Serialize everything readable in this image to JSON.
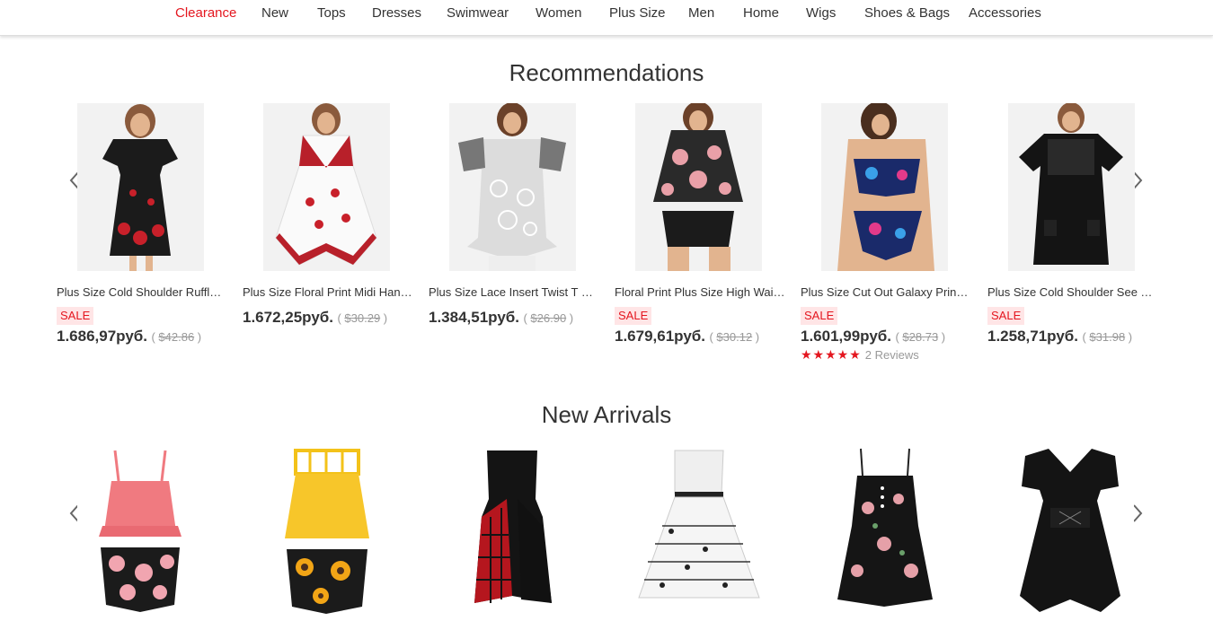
{
  "nav": {
    "items": [
      {
        "label": "Clearance",
        "highlight": true
      },
      {
        "label": "New"
      },
      {
        "label": "Tops"
      },
      {
        "label": "Dresses"
      },
      {
        "label": "Swimwear"
      },
      {
        "label": "Women"
      },
      {
        "label": "Plus Size"
      },
      {
        "label": "Men"
      },
      {
        "label": "Home"
      },
      {
        "label": "Wigs"
      },
      {
        "label": "Shoes & Bags"
      },
      {
        "label": "Accessories"
      }
    ]
  },
  "recommendations": {
    "title": "Recommendations",
    "products": [
      {
        "title": "Plus Size Cold Shoulder Ruffle Floral Print Dress",
        "sale": "SALE",
        "price": "1.686,97руб.",
        "old_price": "$42.86"
      },
      {
        "title": "Plus Size Floral Print Midi Handkerchief Dress",
        "sale": "",
        "price": "1.672,25руб.",
        "old_price": "$30.29"
      },
      {
        "title": "Plus Size Lace Insert Twist T Shirt",
        "sale": "",
        "price": "1.384,51руб.",
        "old_price": "$26.90"
      },
      {
        "title": "Floral Print Plus Size High Waisted Tankini",
        "sale": "SALE",
        "price": "1.679,61руб.",
        "old_price": "$30.12"
      },
      {
        "title": "Plus Size Cut Out Galaxy Print Bikini",
        "sale": "SALE",
        "price": "1.601,99руб.",
        "old_price": "$28.73",
        "stars": "★★★★★",
        "reviews": "2 Reviews"
      },
      {
        "title": "Plus Size Cold Shoulder See Through Dress",
        "sale": "SALE",
        "price": "1.258,71руб.",
        "old_price": "$31.98"
      }
    ]
  },
  "new_arrivals": {
    "title": "New Arrivals",
    "products": [
      {
        "name": "pink-floral-tankini"
      },
      {
        "name": "yellow-sunflower-tankini"
      },
      {
        "name": "black-plaid-dress"
      },
      {
        "name": "music-note-dress"
      },
      {
        "name": "black-floral-cami-top"
      },
      {
        "name": "black-lace-up-dress"
      }
    ]
  },
  "colors": {
    "accent": "#e4161f",
    "sale_bg": "#ffe5e6",
    "text": "#333333",
    "muted": "#999999"
  }
}
